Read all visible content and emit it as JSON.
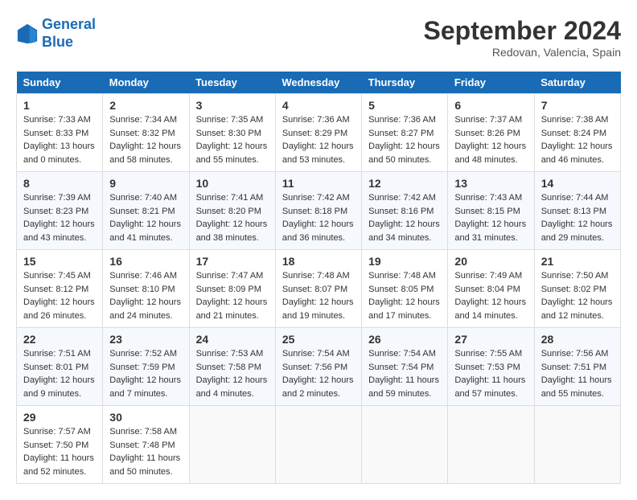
{
  "header": {
    "logo_line1": "General",
    "logo_line2": "Blue",
    "month": "September 2024",
    "location": "Redovan, Valencia, Spain"
  },
  "weekdays": [
    "Sunday",
    "Monday",
    "Tuesday",
    "Wednesday",
    "Thursday",
    "Friday",
    "Saturday"
  ],
  "weeks": [
    [
      {
        "day": "1",
        "sunrise": "7:33 AM",
        "sunset": "8:33 PM",
        "daylight": "13 hours and 0 minutes."
      },
      {
        "day": "2",
        "sunrise": "7:34 AM",
        "sunset": "8:32 PM",
        "daylight": "12 hours and 58 minutes."
      },
      {
        "day": "3",
        "sunrise": "7:35 AM",
        "sunset": "8:30 PM",
        "daylight": "12 hours and 55 minutes."
      },
      {
        "day": "4",
        "sunrise": "7:36 AM",
        "sunset": "8:29 PM",
        "daylight": "12 hours and 53 minutes."
      },
      {
        "day": "5",
        "sunrise": "7:36 AM",
        "sunset": "8:27 PM",
        "daylight": "12 hours and 50 minutes."
      },
      {
        "day": "6",
        "sunrise": "7:37 AM",
        "sunset": "8:26 PM",
        "daylight": "12 hours and 48 minutes."
      },
      {
        "day": "7",
        "sunrise": "7:38 AM",
        "sunset": "8:24 PM",
        "daylight": "12 hours and 46 minutes."
      }
    ],
    [
      {
        "day": "8",
        "sunrise": "7:39 AM",
        "sunset": "8:23 PM",
        "daylight": "12 hours and 43 minutes."
      },
      {
        "day": "9",
        "sunrise": "7:40 AM",
        "sunset": "8:21 PM",
        "daylight": "12 hours and 41 minutes."
      },
      {
        "day": "10",
        "sunrise": "7:41 AM",
        "sunset": "8:20 PM",
        "daylight": "12 hours and 38 minutes."
      },
      {
        "day": "11",
        "sunrise": "7:42 AM",
        "sunset": "8:18 PM",
        "daylight": "12 hours and 36 minutes."
      },
      {
        "day": "12",
        "sunrise": "7:42 AM",
        "sunset": "8:16 PM",
        "daylight": "12 hours and 34 minutes."
      },
      {
        "day": "13",
        "sunrise": "7:43 AM",
        "sunset": "8:15 PM",
        "daylight": "12 hours and 31 minutes."
      },
      {
        "day": "14",
        "sunrise": "7:44 AM",
        "sunset": "8:13 PM",
        "daylight": "12 hours and 29 minutes."
      }
    ],
    [
      {
        "day": "15",
        "sunrise": "7:45 AM",
        "sunset": "8:12 PM",
        "daylight": "12 hours and 26 minutes."
      },
      {
        "day": "16",
        "sunrise": "7:46 AM",
        "sunset": "8:10 PM",
        "daylight": "12 hours and 24 minutes."
      },
      {
        "day": "17",
        "sunrise": "7:47 AM",
        "sunset": "8:09 PM",
        "daylight": "12 hours and 21 minutes."
      },
      {
        "day": "18",
        "sunrise": "7:48 AM",
        "sunset": "8:07 PM",
        "daylight": "12 hours and 19 minutes."
      },
      {
        "day": "19",
        "sunrise": "7:48 AM",
        "sunset": "8:05 PM",
        "daylight": "12 hours and 17 minutes."
      },
      {
        "day": "20",
        "sunrise": "7:49 AM",
        "sunset": "8:04 PM",
        "daylight": "12 hours and 14 minutes."
      },
      {
        "day": "21",
        "sunrise": "7:50 AM",
        "sunset": "8:02 PM",
        "daylight": "12 hours and 12 minutes."
      }
    ],
    [
      {
        "day": "22",
        "sunrise": "7:51 AM",
        "sunset": "8:01 PM",
        "daylight": "12 hours and 9 minutes."
      },
      {
        "day": "23",
        "sunrise": "7:52 AM",
        "sunset": "7:59 PM",
        "daylight": "12 hours and 7 minutes."
      },
      {
        "day": "24",
        "sunrise": "7:53 AM",
        "sunset": "7:58 PM",
        "daylight": "12 hours and 4 minutes."
      },
      {
        "day": "25",
        "sunrise": "7:54 AM",
        "sunset": "7:56 PM",
        "daylight": "12 hours and 2 minutes."
      },
      {
        "day": "26",
        "sunrise": "7:54 AM",
        "sunset": "7:54 PM",
        "daylight": "11 hours and 59 minutes."
      },
      {
        "day": "27",
        "sunrise": "7:55 AM",
        "sunset": "7:53 PM",
        "daylight": "11 hours and 57 minutes."
      },
      {
        "day": "28",
        "sunrise": "7:56 AM",
        "sunset": "7:51 PM",
        "daylight": "11 hours and 55 minutes."
      }
    ],
    [
      {
        "day": "29",
        "sunrise": "7:57 AM",
        "sunset": "7:50 PM",
        "daylight": "11 hours and 52 minutes."
      },
      {
        "day": "30",
        "sunrise": "7:58 AM",
        "sunset": "7:48 PM",
        "daylight": "11 hours and 50 minutes."
      },
      null,
      null,
      null,
      null,
      null
    ]
  ]
}
